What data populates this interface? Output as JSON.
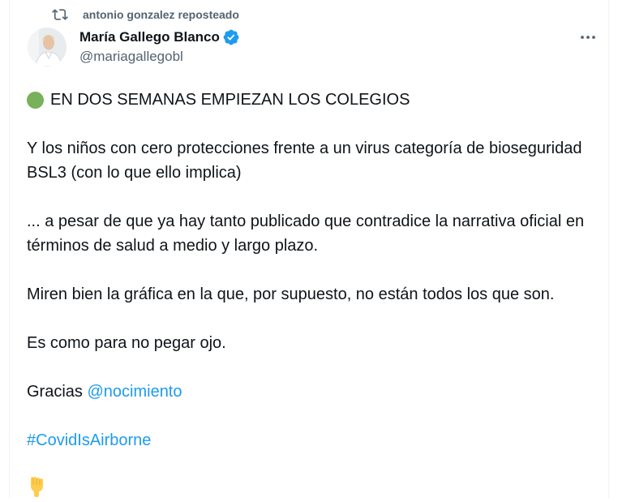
{
  "repost": {
    "icon": "repost-icon",
    "text": "antonio gonzalez reposteado"
  },
  "author": {
    "display_name": "María Gallego Blanco",
    "handle": "@mariagallegobl",
    "verified_icon": "verified-badge-icon",
    "verified_color": "#1d9bf0"
  },
  "menu": {
    "icon": "more-options-icon"
  },
  "post": {
    "headline_icon": "green-circle-icon",
    "headline": "EN DOS SEMANAS EMPIEZAN LOS COLEGIOS",
    "p1": "Y los niños con cero protecciones frente a un virus categoría de bioseguridad BSL3 (con lo que ello implica)",
    "p2": "...  a pesar de que ya hay tanto publicado que contradice la narrativa oficial en términos de salud a medio y largo plazo.",
    "p3": "Miren bien la gráfica en la que, por supuesto, no están todos los que son.",
    "p4": "Es como para no pegar ojo.",
    "thanks_prefix": "Gracias ",
    "mention": "@nocimiento",
    "hashtag": "#CovidIsAirborne",
    "trailing_icon": "pointing-down-hand-icon"
  },
  "colors": {
    "link": "#1d9bf0",
    "secondary_text": "#536471",
    "primary_text": "#0f1419",
    "green_circle": "#78b159"
  }
}
